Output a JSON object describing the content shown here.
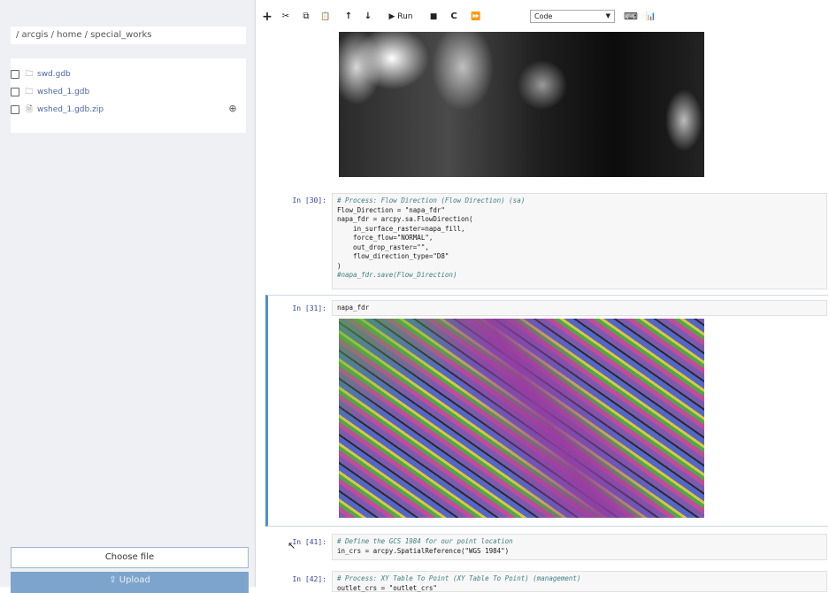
{
  "sidebar": {
    "breadcrumb": "/ arcgis / home / special_works",
    "files": [
      {
        "name": "swd.gdb",
        "icon": "folder-icon"
      },
      {
        "name": "wshed_1.gdb",
        "icon": "folder-icon"
      },
      {
        "name": "wshed_1.gdb.zip",
        "icon": "file-icon"
      }
    ],
    "choose_file_label": "Choose file",
    "upload_label": "Upload"
  },
  "toolbar": {
    "add": "+",
    "cut": "✂",
    "copy": "⧉",
    "paste": "📋",
    "move_up": "↑",
    "move_down": "↓",
    "run_label": "▶ Run",
    "stop": "■",
    "restart": "C",
    "restart_run_all": "⏩",
    "cell_type": "Code",
    "keyboard": "⌨",
    "chart": "📊"
  },
  "cells": {
    "c30": {
      "prompt": "In [30]:",
      "lines": [
        "# Process: Flow Direction (Flow Direction) (sa)",
        "Flow_Direction = \"napa_fdr\"",
        "napa_fdr = arcpy.sa.FlowDirection(",
        "    in_surface_raster=napa_fill,",
        "    force_flow=\"NORMAL\",",
        "    out_drop_raster=\"\",",
        "    flow_direction_type=\"D8\"",
        ")",
        "#napa_fdr.save(Flow_Direction)"
      ]
    },
    "c31": {
      "prompt": "In [31]:",
      "code": "napa_fdr"
    },
    "c41": {
      "prompt": "In [41]:",
      "lines": [
        "# Define the GCS 1984 for our point location",
        "in_crs = arcpy.SpatialReference(\"WGS 1984\")"
      ]
    },
    "c42": {
      "prompt": "In [42]:",
      "lines": [
        "# Process: XY Table To Point (XY Table To Point) (management)",
        "outlet_crs = \"outlet_crs\""
      ]
    }
  },
  "colors": {
    "accent": "#4d90c9",
    "upload_bg": "#7da4cc",
    "prompt": "#303f9f"
  }
}
